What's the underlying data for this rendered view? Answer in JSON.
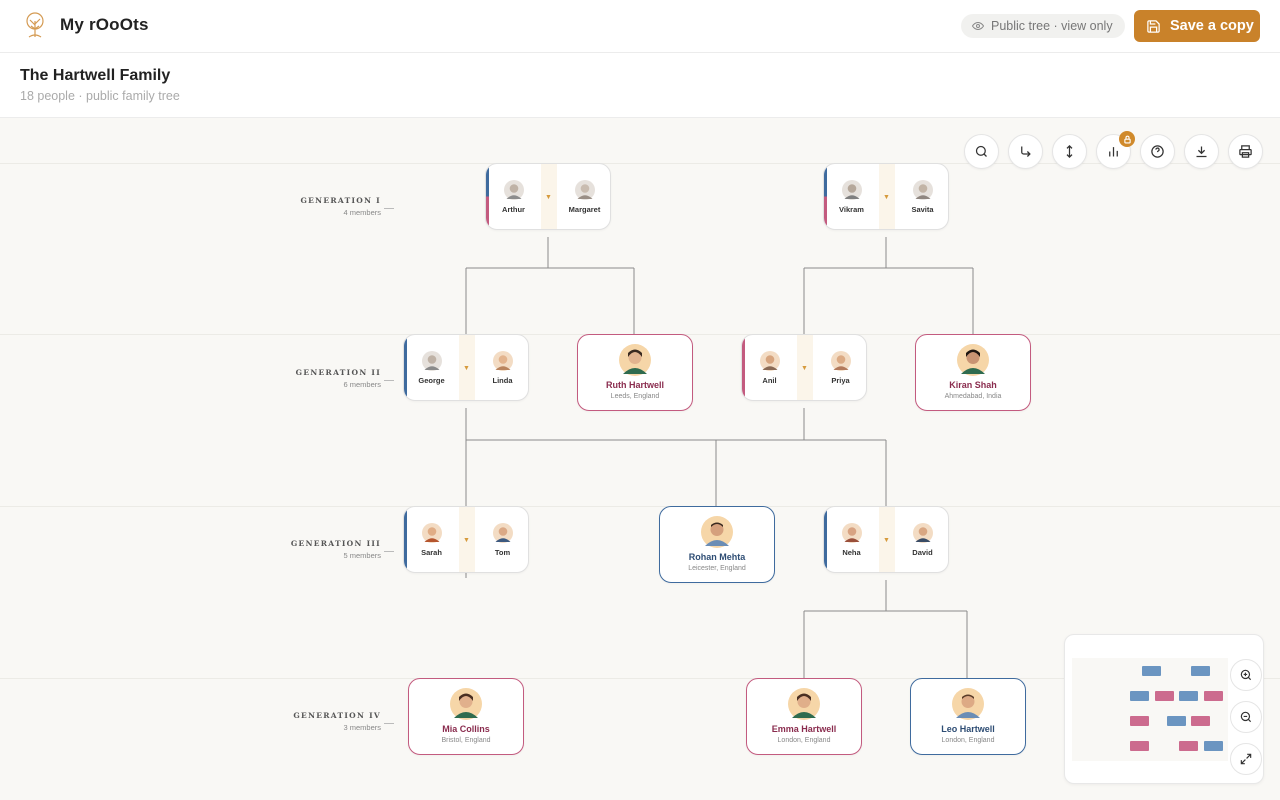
{
  "app": {
    "title": "My rOoOts",
    "logo_icon": "tree-icon"
  },
  "topbar": {
    "public_label": "Public tree · view only",
    "public_icon": "eye-icon",
    "save_label": "Save a copy",
    "save_icon": "save-icon"
  },
  "tree": {
    "title": "The Hartwell Family",
    "subtitle": "18 people · public family tree"
  },
  "generations": [
    {
      "name": "GENERATION I",
      "count": "4 members"
    },
    {
      "name": "GENERATION II",
      "count": "6 members"
    },
    {
      "name": "GENERATION III",
      "count": "5 members"
    },
    {
      "name": "GENERATION IV",
      "count": "3 members"
    }
  ],
  "couples": {
    "arthur_margaret": {
      "a": "Arthur",
      "b": "Margaret"
    },
    "vikram_savita": {
      "a": "Vikram",
      "b": "Savita"
    },
    "george_linda": {
      "a": "George",
      "b": "Linda"
    },
    "anil_priya": {
      "a": "Anil",
      "b": "Priya"
    },
    "sarah_tom": {
      "a": "Sarah",
      "b": "Tom"
    },
    "neha_david": {
      "a": "Neha",
      "b": "David"
    }
  },
  "people": {
    "ruth": {
      "name": "Ruth Hartwell",
      "location": "Leeds, England"
    },
    "kiran": {
      "name": "Kiran Shah",
      "location": "Ahmedabad, India"
    },
    "rohan": {
      "name": "Rohan Mehta",
      "location": "Leicester, England"
    },
    "mia": {
      "name": "Mia Collins",
      "location": "Bristol, England"
    },
    "emma": {
      "name": "Emma Hartwell",
      "location": "London, England"
    },
    "leo": {
      "name": "Leo Hartwell",
      "location": "London, England"
    }
  },
  "toolbar": [
    "search-icon",
    "redirect-arrow-icon",
    "vertical-arrows-icon",
    "bar-chart-icon",
    "help-icon",
    "download-icon",
    "print-icon"
  ],
  "colors": {
    "accent": "#c9822a",
    "female": "#c35b7f",
    "male": "#3f6b9e",
    "canvas": "#f9f8f5"
  }
}
